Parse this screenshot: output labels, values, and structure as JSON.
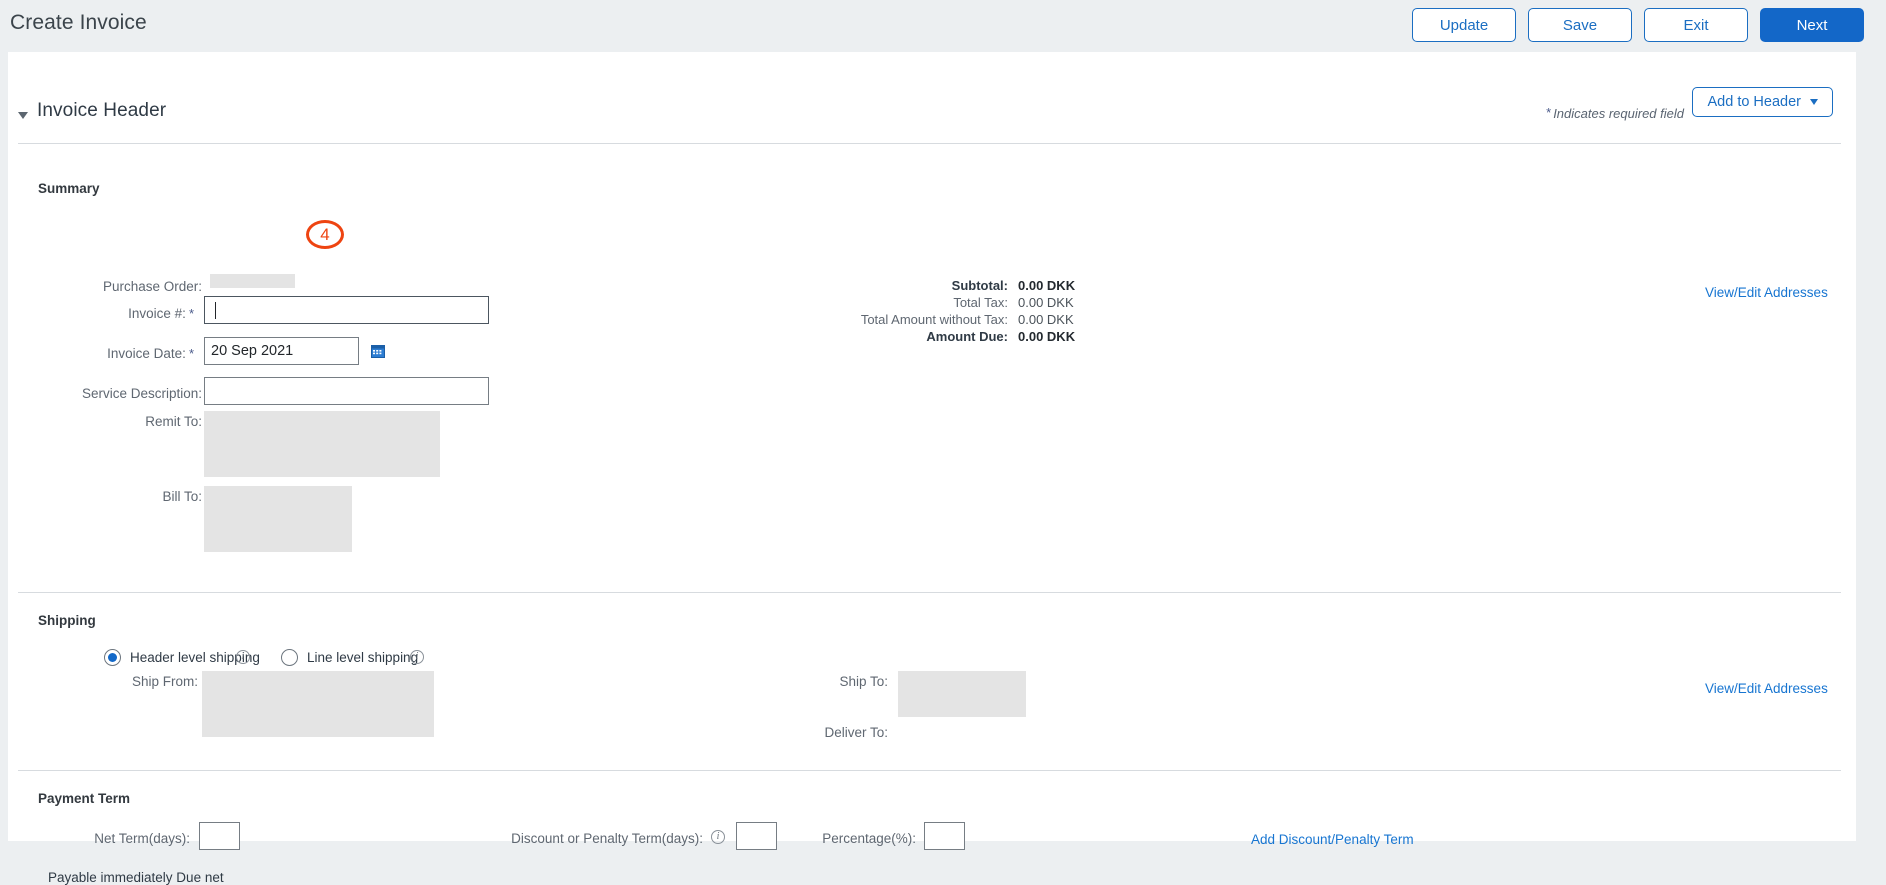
{
  "page": {
    "title": "Create Invoice"
  },
  "toolbar": {
    "buttons": [
      {
        "label": "Update",
        "primary": false
      },
      {
        "label": "Save",
        "primary": false
      },
      {
        "label": "Exit",
        "primary": false
      },
      {
        "label": "Next",
        "primary": true
      }
    ]
  },
  "invoice_header": {
    "section_title": "Invoice Header",
    "required_note": "Indicates required field",
    "required_star": "*",
    "add_to_header_label": "Add to Header"
  },
  "summary": {
    "group_label": "Summary",
    "fields": {
      "purchase_order_label": "Purchase Order:",
      "purchase_order_value": "",
      "invoice_number_label": "Invoice #:",
      "invoice_number_value": "",
      "invoice_date_label": "Invoice Date:",
      "invoice_date_value": "20 Sep 2021",
      "service_description_label": "Service Description:",
      "service_description_value": "",
      "remit_to_label": "Remit To:",
      "remit_to_value": "",
      "bill_to_label": "Bill To:",
      "bill_to_value": ""
    },
    "totals": [
      {
        "label": "Subtotal:",
        "value": "0.00 DKK",
        "bold": true
      },
      {
        "label": "Total Tax:",
        "value": "0.00 DKK",
        "bold": false
      },
      {
        "label": "Total Amount without Tax:",
        "value": "0.00 DKK",
        "bold": false
      },
      {
        "label": "Amount Due:",
        "value": "0.00 DKK",
        "bold": true
      }
    ],
    "view_edit_addresses_link": "View/Edit Addresses"
  },
  "shipping": {
    "group_label": "Shipping",
    "header_level_label": "Header level shipping",
    "line_level_label": "Line level shipping",
    "selected": "header",
    "ship_from_label": "Ship From:",
    "ship_to_label": "Ship To:",
    "deliver_to_label": "Deliver To:",
    "view_edit_addresses_link": "View/Edit Addresses"
  },
  "payment_term": {
    "group_label": "Payment Term",
    "net_term_label": "Net Term(days):",
    "net_term_value": "",
    "discount_penalty_label": "Discount or Penalty Term(days):",
    "discount_penalty_value": "",
    "percentage_label": "Percentage(%):",
    "percentage_value": "",
    "note": "Payable immediately Due net",
    "add_discount_link": "Add Discount/Penalty Term"
  },
  "annotations": [
    {
      "id": "4",
      "label": "4"
    }
  ],
  "colors": {
    "accent_blue": "#1367c8",
    "link_blue": "#1775d1",
    "annotation_orange": "#ee4411",
    "chrome_gray": "#eceff1",
    "placeholder_gray": "#e4e4e4"
  }
}
